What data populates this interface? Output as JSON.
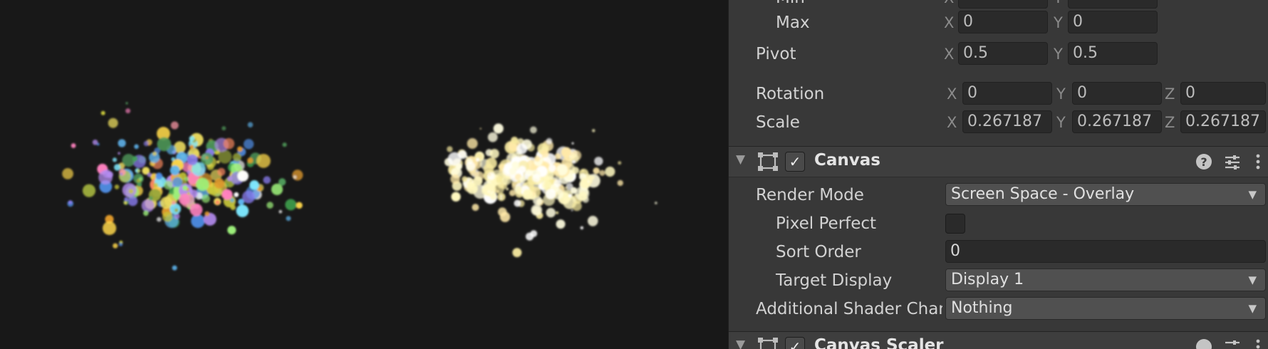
{
  "scene": {
    "left_cluster_colors": [
      "#4f8fe8",
      "#5fb6f0",
      "#8a7cf0",
      "#b48cf0",
      "#ff82c0",
      "#ff9aa8",
      "#7ee8ff",
      "#ffffff",
      "#9cf07a",
      "#3fa34f",
      "#4f9a5a",
      "#f0e060",
      "#ffd84a",
      "#c8c83a",
      "#e09a2c",
      "#ff8a60",
      "#9aa83a"
    ],
    "right_cluster_colors": [
      "#fffde0",
      "#fff8c0",
      "#f7eaa0",
      "#ffe9a8",
      "#ffffff"
    ]
  },
  "inspector": {
    "anchors": {
      "min_label": "Min",
      "max_label": "Max",
      "max_x": "0",
      "max_y": "0"
    },
    "pivot": {
      "label": "Pivot",
      "x": "0.5",
      "y": "0.5"
    },
    "rotation": {
      "label": "Rotation",
      "x": "0",
      "y": "0",
      "z": "0"
    },
    "scale": {
      "label": "Scale",
      "x": "0.267187",
      "y": "0.267187",
      "z": "0.267187"
    },
    "axis": {
      "x": "X",
      "y": "Y",
      "z": "Z"
    },
    "canvas": {
      "title": "Canvas",
      "enabled": "✓",
      "render_mode_label": "Render Mode",
      "render_mode_value": "Screen Space - Overlay",
      "pixel_perfect_label": "Pixel Perfect",
      "sort_order_label": "Sort Order",
      "sort_order_value": "0",
      "target_display_label": "Target Display",
      "target_display_value": "Display 1",
      "shader_channels_label": "Additional Shader Chan",
      "shader_channels_value": "Nothing"
    },
    "canvas_scaler": {
      "title": "Canvas Scaler",
      "enabled": "✓"
    },
    "icons": [
      "help-icon",
      "preset-icon",
      "kebab-menu-icon",
      "rect-transform-icon"
    ]
  }
}
